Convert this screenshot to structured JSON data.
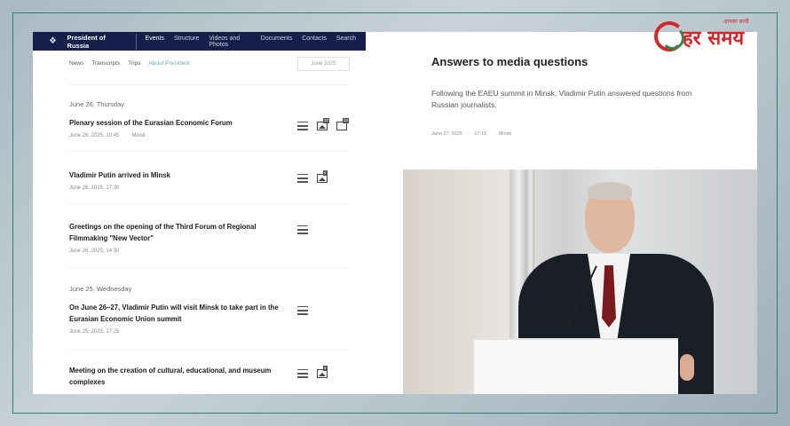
{
  "site": {
    "brand": "President of Russia",
    "nav": [
      "Events",
      "Structure",
      "Videos and Photos",
      "Documents",
      "Contacts",
      "Search"
    ],
    "subnav": [
      "News",
      "Transcripts",
      "Trips",
      "About President"
    ],
    "date_filter": "June 2025"
  },
  "news": {
    "day1_label": "June 26, Thursday",
    "items": [
      {
        "title": "Plenary session of the Eurasian Economic Forum",
        "date": "June 26, 2025, 10:45",
        "place": "Minsk",
        "photo_count": "10",
        "video_count": "15"
      },
      {
        "title": "Vladimir Putin arrived in Minsk",
        "date": "June 26, 2025, 17:30",
        "photo_count": "4"
      },
      {
        "title": "Greetings on the opening of the Third Forum of Regional Filmmaking \"New Vector\"",
        "date": "June 26, 2025, 14:30"
      },
      {
        "title": "On June 26–27, Vladimir Putin will visit Minsk to take part in the Eurasian Economic Union summit",
        "date": "June 25, 2025, 17:25"
      },
      {
        "title": "Meeting on the creation of cultural, educational, and museum complexes",
        "photo_count": "4"
      }
    ],
    "day2_label": "June 25, Wednesday"
  },
  "article": {
    "title": "Answers to media questions",
    "lead": "Following the EAEU summit in Minsk, Vladimir Putin answered questions from Russian journalists.",
    "date": "June 27, 2025",
    "time": "17:15",
    "place": "Minsk"
  },
  "logo": {
    "name": "हर समय",
    "tagline": "आपका साथी"
  },
  "colors": {
    "topbar": "#14204a",
    "frame": "#2f7f74",
    "logo_red": "#d1262b",
    "logo_green": "#2f8a4a"
  }
}
